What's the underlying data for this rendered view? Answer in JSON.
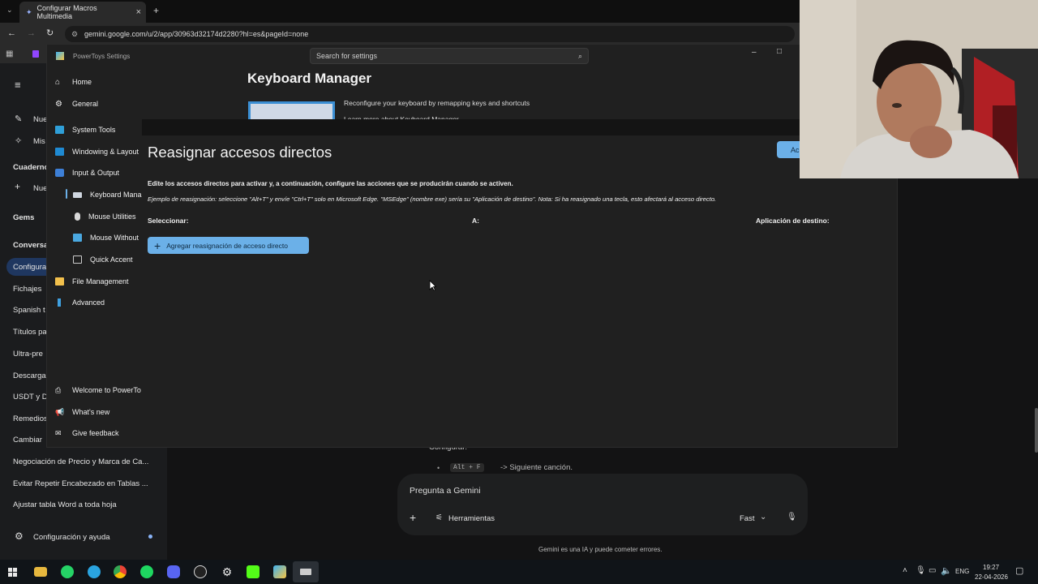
{
  "browser": {
    "tab_title": "Configurar Macros Multimedia",
    "url": "gemini.google.com/u/2/app/30963d32174d2280?hl=es&pageId=none"
  },
  "gemini": {
    "sidebar": {
      "items": [
        "Nue",
        "Mis",
        "Cuaderno",
        "Nue",
        "Gems",
        "Conversa",
        "Configura",
        "Fichajes",
        "Spanish t",
        "Títulos pa",
        "Ultra-pre",
        "Descarga",
        "USDT y D",
        "Remedios",
        "Cambiar",
        "Negociación de Precio y Marca de Ca...",
        "Evitar Repetir Encabezado en Tablas ...",
        "Ajustar tabla Word a toda hoja"
      ],
      "settings_label": "Configuración y ayuda"
    },
    "chat_fragment": {
      "text": "Configurar:",
      "shortcut": "Alt + F",
      "shortcut_action": "-> Siguiente canción."
    },
    "prompt": {
      "placeholder": "Pregunta a Gemini",
      "tools_label": "Herramientas",
      "model_label": "Fast"
    },
    "disclaimer": "Gemini es una IA y puede cometer errores."
  },
  "powertoys": {
    "window_title": "PowerToys Settings",
    "search_placeholder": "Search for settings",
    "nav": {
      "home": "Home",
      "general": "General",
      "system_tools": "System Tools",
      "windowing": "Windowing & Layout",
      "input_output": "Input & Output",
      "keyboard_manager": "Keyboard Mana",
      "mouse_utilities": "Mouse Utilities",
      "mouse_without": "Mouse Without",
      "quick_accent": "Quick Accent",
      "file_management": "File Management",
      "advanced": "Advanced",
      "welcome": "Welcome to PowerTo",
      "whats_new": "What's new",
      "feedback": "Give feedback"
    },
    "page_title": "Keyboard Manager",
    "page_desc": "Reconfigure your keyboard by remapping keys and shortcuts",
    "page_link": "Learn more about Keyboard Manager",
    "dialog": {
      "title": "Reasignar accesos directos",
      "accept_label": "Ac",
      "description": "Edite los accesos directos para activar y, a continuación, configure las acciones que se producirán cuando se activen.",
      "example": "Ejemplo de reasignación: seleccione \"Alt+T\" y envíe \"Ctrl+T\" solo en Microsoft Edge. \"MSEdge\" (nombre exe) sería su \"Aplicación de destino\". Nota: Si ha reasignado una tecla, esto afectará al acceso directo.",
      "col_select": "Seleccionar:",
      "col_to": "A:",
      "col_target": "Aplicación de destino:",
      "add_button": "Agregar reasignación de acceso directo"
    }
  },
  "taskbar": {
    "language": "ENG",
    "time": "19:27",
    "date": "22-04-2026"
  }
}
